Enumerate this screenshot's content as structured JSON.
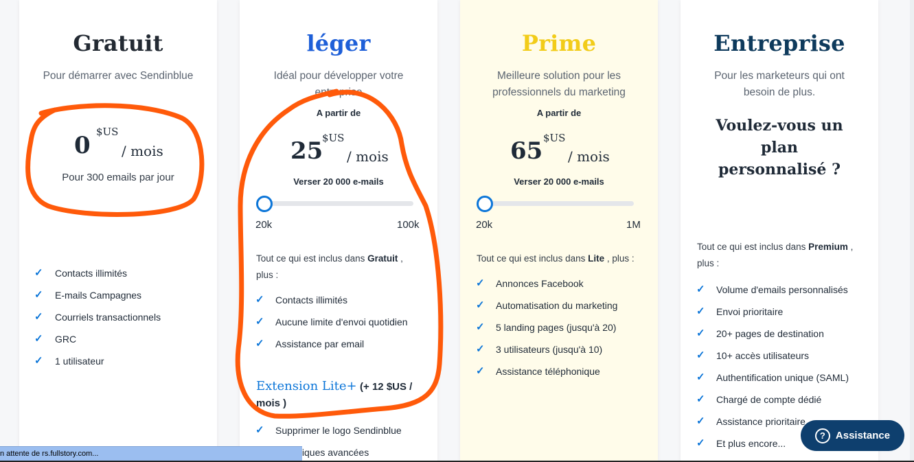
{
  "plans": {
    "free": {
      "title": "Gratuit",
      "title_color": "#232a33",
      "subtitle": "Pour démarrer avec Sendinblue",
      "price": "0",
      "currency": "$US",
      "per": "/ mois",
      "note": "Pour 300 emails par jour",
      "features": [
        "Contacts illimités",
        "E-mails Campagnes",
        "Courriels transactionnels",
        "GRC",
        "1 utilisateur"
      ]
    },
    "lite": {
      "title": "léger",
      "title_color": "#1e5fd8",
      "subtitle": "Idéal pour développer votre entreprise",
      "from_label": "A partir de",
      "price": "25",
      "currency": "$US",
      "per": "/ mois",
      "volume": "Verser 20 000 e-mails",
      "slider_min": "20k",
      "slider_max": "100k",
      "slider_value": 0,
      "includes_prefix": "Tout ce qui est inclus dans",
      "includes_plan": "Gratuit",
      "includes_suffix": ", plus :",
      "features": [
        "Contacts illimités",
        "Aucune limite d'envoi quotidien",
        "Assistance par email"
      ],
      "extension_title": "Extension Lite+",
      "extension_price": "(+ 12 $US / mois )",
      "extension_features": [
        "Supprimer le logo Sendinblue",
        "Statistiques avancées"
      ]
    },
    "premium": {
      "title": "Prime",
      "title_color": "#f2cc19",
      "subtitle": "Meilleure solution pour les professionnels du marketing",
      "from_label": "A partir de",
      "price": "65",
      "currency": "$US",
      "per": "/ mois",
      "volume": "Verser 20 000 e-mails",
      "slider_min": "20k",
      "slider_max": "1M",
      "slider_value": 0,
      "includes_prefix": "Tout ce qui est inclus dans",
      "includes_plan": "Lite",
      "includes_suffix": ", plus :",
      "features": [
        "Annonces Facebook",
        "Automatisation du marketing",
        "5 landing pages (jusqu'à 20)",
        "3 utilisateurs (jusqu'à 10)",
        "Assistance téléphonique"
      ]
    },
    "enterprise": {
      "title": "Entreprise",
      "title_color": "#0e3a5c",
      "subtitle": "Pour les marketeurs qui ont besoin de plus.",
      "question": "Voulez-vous un plan personnalisé ?",
      "includes_prefix": "Tout ce qui est inclus dans",
      "includes_plan": "Premium",
      "includes_suffix": ", plus :",
      "features": [
        "Volume d'emails personnalisés",
        "Envoi prioritaire",
        "20+ pages de destination",
        "10+ accès utilisateurs",
        "Authentification unique (SAML)",
        "Chargé de compte dédié",
        "Assistance prioritaire",
        "Et plus encore..."
      ]
    }
  },
  "status_bar": "n attente de rs.fullstory.com...",
  "assistance_button": "Assistance",
  "colors": {
    "accent": "#0b75d8",
    "annotation": "#ff5a0a",
    "dark_navy": "#0e3f6e"
  },
  "icons": {
    "check": "check-icon",
    "help": "question-circle-icon"
  }
}
